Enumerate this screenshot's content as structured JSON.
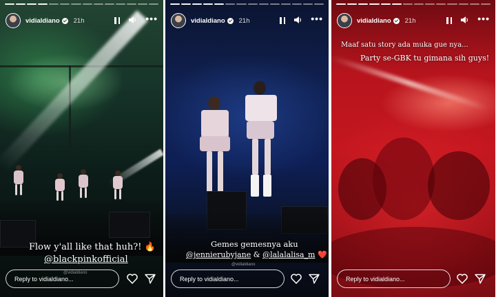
{
  "stories": [
    {
      "username": "vidialdiano",
      "time": "21h",
      "caption_lines": [
        {
          "text": "Flow y'all like that huh?! 🔥",
          "mention": false
        },
        {
          "text": "@blackpinkofficial",
          "mention": true
        }
      ],
      "watermark": "@vidialdiano",
      "reply_placeholder": "Reply to vidialdiano...",
      "icons": [
        "pause-icon",
        "sound-icon",
        "more-icon",
        "heart-icon",
        "send-icon"
      ]
    },
    {
      "username": "vidialdiano",
      "time": "21h",
      "caption_lines": [
        {
          "text": "Gemes gemesnya aku",
          "mention": false
        },
        {
          "text": "@jennierubyjane",
          "mention": true
        },
        {
          "text": " & ",
          "mention": false
        },
        {
          "text": "@lalalalisa_m",
          "mention": true
        },
        {
          "text": " ❤️",
          "mention": false
        }
      ],
      "watermark": "@vidialdiano",
      "reply_placeholder": "Reply to vidialdiano...",
      "icons": [
        "pause-icon",
        "sound-icon",
        "more-icon",
        "heart-icon",
        "send-icon"
      ]
    },
    {
      "username": "vidialdiano",
      "time": "21h",
      "caption_lines": [
        {
          "text": "Maaf satu story ada muka gue nya...",
          "mention": false
        },
        {
          "text": "Party se-GBK tu gimana sih guys!",
          "mention": false
        }
      ],
      "reply_placeholder": "Reply to vidialdiano...",
      "icons": [
        "pause-icon",
        "sound-icon",
        "more-icon",
        "heart-icon",
        "send-icon"
      ]
    }
  ],
  "colors": {
    "story1_tint": "#17352a",
    "story2_tint": "#102152",
    "story3_tint": "#c3161f",
    "text": "#ffffff"
  }
}
